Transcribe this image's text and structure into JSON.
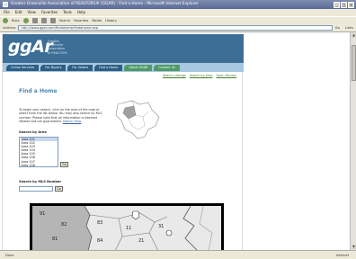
{
  "window": {
    "title": "Greater Greenville Association of REALTORS® (GGAR) - Find a Home - Microsoft Internet Explorer",
    "buttons": [
      "_",
      "□",
      "×"
    ]
  },
  "menubar": [
    "File",
    "Edit",
    "View",
    "Favorites",
    "Tools",
    "Help"
  ],
  "toolbar": {
    "back": "Back",
    "search": "Search",
    "favorites": "Favorites",
    "media": "Media",
    "history": "History"
  },
  "addressbar": {
    "label": "Address",
    "url": "http://www.ggar.com/findahome/findahome.asp",
    "go": "Go",
    "links": "Links"
  },
  "site": {
    "logo": "ggAr",
    "org": [
      "Greater",
      "Greenville",
      "Association",
      "of REALTORS"
    ],
    "nav": [
      "Online Services",
      "For Buyers",
      "For Sellers",
      "Find a Home",
      "About GGAR",
      "Contact Us"
    ],
    "subnav": [
      "Search Listings",
      "Search by Area",
      "Open Houses"
    ],
    "content": {
      "title": "Find a Home",
      "intro": "To begin your search, click on the area of the map or select from the list below. You may also search by MLS number. Please note that all information is deemed reliable but not guaranteed.",
      "link_text": "Search Help",
      "area_label": "Search by Area",
      "areas": [
        "Area 101",
        "Area 102",
        "Area 103",
        "Area 104",
        "Area 105",
        "Area 106",
        "Area 107",
        "Area 108"
      ],
      "go_label": "Go",
      "mls_label": "Search by MLS Number",
      "mls_go": "Go"
    },
    "map_labels": [
      "82",
      "81",
      "83",
      "84",
      "11",
      "21",
      "31",
      "91"
    ]
  },
  "statusbar": {
    "left": "Done",
    "zone": "Internet"
  }
}
